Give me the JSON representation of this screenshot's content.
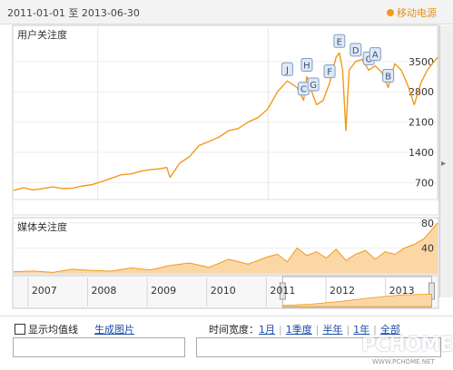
{
  "header": {
    "date_range": "2011-01-01 至 2013-06-30",
    "legend_label": "移动电源",
    "legend_color": "#f19a1b"
  },
  "panels": {
    "user_title": "用户关注度",
    "media_title": "媒体关注度"
  },
  "controls": {
    "show_avg_label": "显示均值线",
    "generate_image": "生成图片",
    "time_width_label": "时间宽度：",
    "time_options": [
      "1月",
      "1季度",
      "半年",
      "1年",
      "全部"
    ]
  },
  "watermark": {
    "brand": "PCHOME",
    "url": "WWW.PCHOME.NET"
  },
  "chart_data": [
    {
      "type": "line",
      "title": "用户关注度",
      "series": [
        {
          "x": [
            "2011-01-01",
            "2011-01-22",
            "2011-02-12",
            "2011-03-05",
            "2011-03-26",
            "2011-04-16",
            "2011-05-07",
            "2011-05-28",
            "2011-06-18",
            "2011-07-09",
            "2011-07-30",
            "2011-08-20",
            "2011-09-10",
            "2011-10-01",
            "2011-10-22",
            "2011-11-12",
            "2011-11-26",
            "2011-12-03",
            "2011-12-24",
            "2012-01-14",
            "2012-02-04",
            "2012-02-25",
            "2012-03-17",
            "2012-04-07",
            "2012-04-28",
            "2012-05-19",
            "2012-06-09",
            "2012-06-30",
            "2012-07-21",
            "2012-08-11",
            "2012-09-01",
            "2012-09-15",
            "2012-09-22",
            "2012-10-06",
            "2012-10-13",
            "2012-10-27",
            "2012-11-10",
            "2012-11-24",
            "2012-12-01",
            "2012-12-08",
            "2012-12-15",
            "2012-12-22",
            "2013-01-05",
            "2013-01-19",
            "2013-02-02",
            "2013-02-16",
            "2013-03-02",
            "2013-03-16",
            "2013-03-30",
            "2013-04-13",
            "2013-04-27",
            "2013-05-11",
            "2013-05-25",
            "2013-06-08",
            "2013-06-30"
          ],
          "values": [
            520,
            580,
            530,
            560,
            600,
            560,
            570,
            620,
            650,
            720,
            800,
            880,
            900,
            960,
            1000,
            1020,
            1050,
            820,
            1150,
            1300,
            1560,
            1650,
            1750,
            1900,
            1950,
            2100,
            2200,
            2400,
            2800,
            3050,
            2900,
            2600,
            3150,
            2700,
            2500,
            2600,
            3000,
            3600,
            3700,
            3300,
            1900,
            3300,
            3500,
            3550,
            3300,
            3400,
            3250,
            2900,
            3450,
            3300,
            2950,
            2500,
            3000,
            3300,
            3600
          ]
        }
      ],
      "xlabel": "",
      "ylabel": "",
      "xtick_labels": [
        "2011年",
        "2012年",
        "20"
      ],
      "ytick_labels": [
        "700",
        "1400",
        "2100",
        "2800",
        "3500"
      ],
      "ylim": [
        350,
        4000
      ],
      "grid": true,
      "annotations": [
        "J",
        "C",
        "H",
        "G",
        "F",
        "E",
        "D",
        "C",
        "A",
        "B"
      ]
    },
    {
      "type": "area",
      "title": "媒体关注度",
      "series": [
        {
          "x": [
            "2011-01-01",
            "2011-02-12",
            "2011-03-26",
            "2011-05-07",
            "2011-06-18",
            "2011-07-30",
            "2011-09-10",
            "2011-10-22",
            "2011-12-03",
            "2012-01-14",
            "2012-02-25",
            "2012-04-07",
            "2012-05-19",
            "2012-06-30",
            "2012-07-21",
            "2012-08-11",
            "2012-09-01",
            "2012-09-22",
            "2012-10-13",
            "2012-11-03",
            "2012-11-24",
            "2012-12-15",
            "2013-01-05",
            "2013-01-26",
            "2013-02-16",
            "2013-03-09",
            "2013-03-30",
            "2013-04-20",
            "2013-05-11",
            "2013-06-01",
            "2013-06-30"
          ],
          "values": [
            2,
            3,
            1,
            6,
            4,
            3,
            8,
            5,
            12,
            16,
            9,
            22,
            14,
            26,
            30,
            18,
            40,
            28,
            34,
            24,
            38,
            20,
            30,
            36,
            22,
            34,
            30,
            40,
            46,
            55,
            80
          ]
        }
      ],
      "xlabel": "",
      "ylabel": "",
      "ytick_labels": [
        "40",
        "80"
      ],
      "ylim": [
        0,
        80
      ],
      "grid": true
    },
    {
      "type": "area",
      "title": "",
      "xtick_labels": [
        "2007",
        "2008",
        "2009",
        "2010",
        "2011",
        "2012",
        "2013"
      ],
      "series": [
        {
          "x": [
            "2011",
            "2011.5",
            "2012",
            "2012.5",
            "2013",
            "2013.5"
          ],
          "values": [
            300,
            700,
            1500,
            2500,
            3300,
            3500
          ]
        }
      ]
    }
  ]
}
